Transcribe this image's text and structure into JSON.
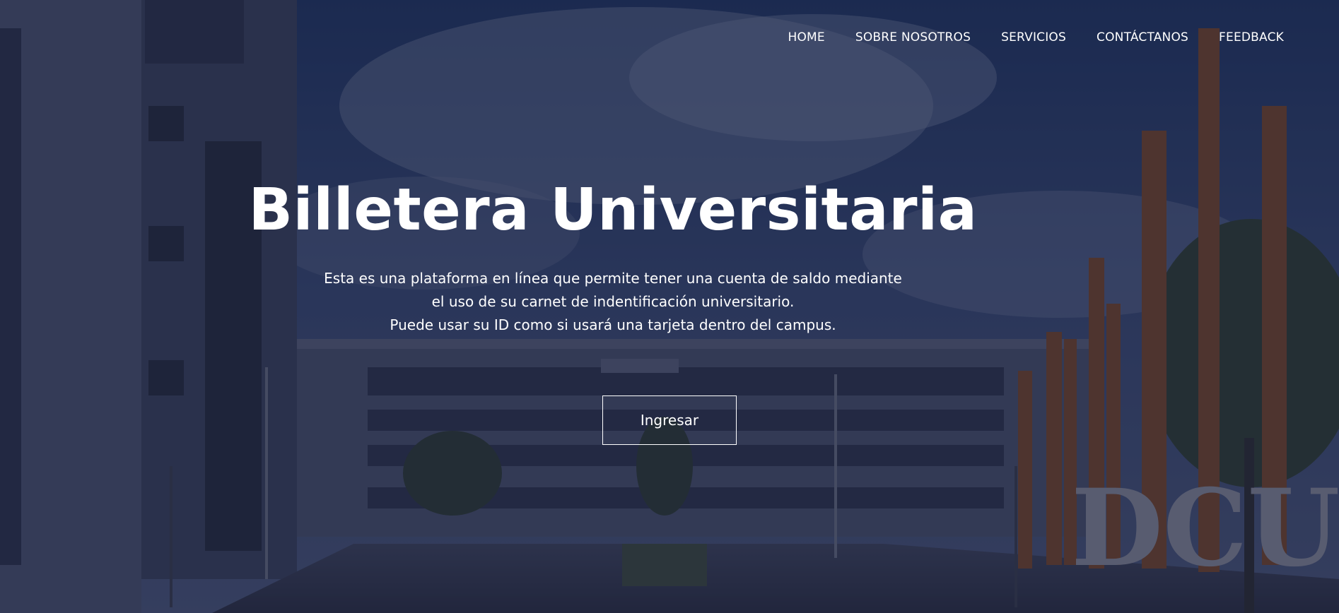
{
  "nav": {
    "items": [
      {
        "label": "HOME"
      },
      {
        "label": "SOBRE NOSOTROS"
      },
      {
        "label": "SERVICIOS"
      },
      {
        "label": "CONTÁCTANOS"
      },
      {
        "label": "FEEDBACK"
      }
    ]
  },
  "hero": {
    "title": "Billetera Universitaria",
    "description_lines": [
      "Esta es una plataforma en línea que permite tener una cuenta de saldo mediante",
      "el uso de su carnet de indentificación universitario.",
      "Puede usar su ID como si usará una tarjeta dentro del campus."
    ],
    "button_label": "Ingresar",
    "signage_text": "DCU"
  },
  "colors": {
    "overlay": "#18203e",
    "text": "#ffffff",
    "sky": "#1c2b4f",
    "rust": "#8a4b25"
  }
}
